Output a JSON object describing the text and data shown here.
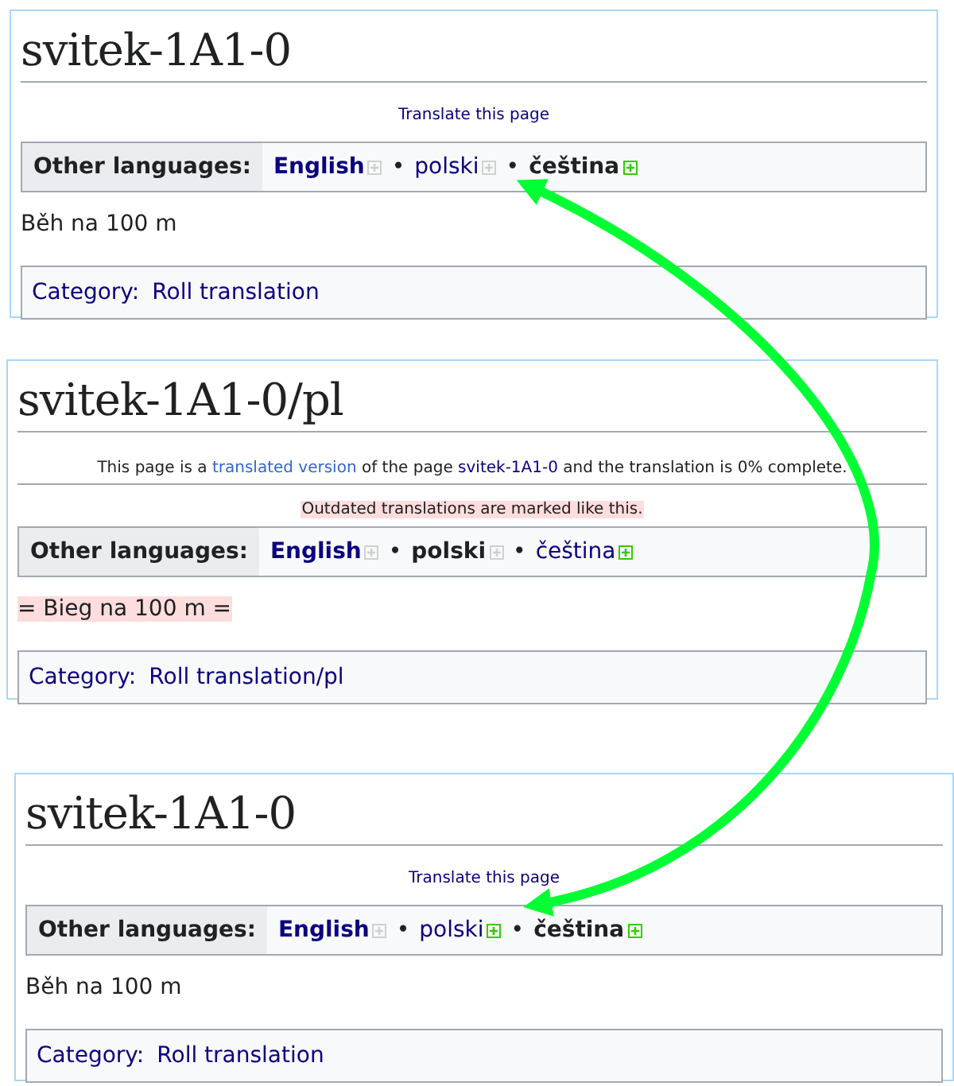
{
  "panels": [
    {
      "title": "svitek-1A1-0",
      "translate_link": "Translate this page",
      "languages_label": "Other languages:",
      "languages": [
        {
          "name": "English",
          "source": true,
          "current": false,
          "translated": false
        },
        {
          "name": "polski",
          "prefix": "•",
          "source": false,
          "current": false,
          "translated": false
        },
        {
          "name": "čeština",
          "prefix": "•",
          "source": false,
          "current": true,
          "translated": true
        }
      ],
      "content": {
        "text": "Běh na 100 m",
        "outdated": false
      },
      "category_label": "Category:",
      "category": "Roll translation"
    },
    {
      "title": "svitek-1A1-0/pl",
      "notice": [
        {
          "kind": "text",
          "text": "This page is a "
        },
        {
          "kind": "link",
          "text": "translated version"
        },
        {
          "kind": "text",
          "text": " of the page "
        },
        {
          "kind": "page-link",
          "text": "svitek-1A1-0"
        },
        {
          "kind": "text",
          "text": " and the translation is 0% complete."
        }
      ],
      "outdated_notice": "Outdated translations are marked like this.",
      "languages_label": "Other languages:",
      "languages": [
        {
          "name": "English",
          "source": true,
          "current": false,
          "translated": false
        },
        {
          "name": "polski",
          "prefix": "•",
          "source": false,
          "current": true,
          "translated": false
        },
        {
          "name": "čeština",
          "prefix": "•",
          "source": false,
          "current": false,
          "translated": true
        }
      ],
      "content": {
        "text": "= Bieg na 100 m =",
        "outdated": true
      },
      "category_label": "Category:",
      "category": "Roll translation/pl"
    },
    {
      "title": "svitek-1A1-0",
      "translate_link": "Translate this page",
      "languages_label": "Other languages:",
      "languages": [
        {
          "name": "English",
          "source": true,
          "current": false,
          "translated": false
        },
        {
          "name": "polski",
          "prefix": "•",
          "source": false,
          "current": false,
          "translated": true
        },
        {
          "name": "čeština",
          "prefix": "•",
          "source": false,
          "current": true,
          "translated": true
        }
      ],
      "content": {
        "text": "Běh na 100 m",
        "outdated": false
      },
      "category_label": "Category:",
      "category": "Roll translation"
    }
  ]
}
